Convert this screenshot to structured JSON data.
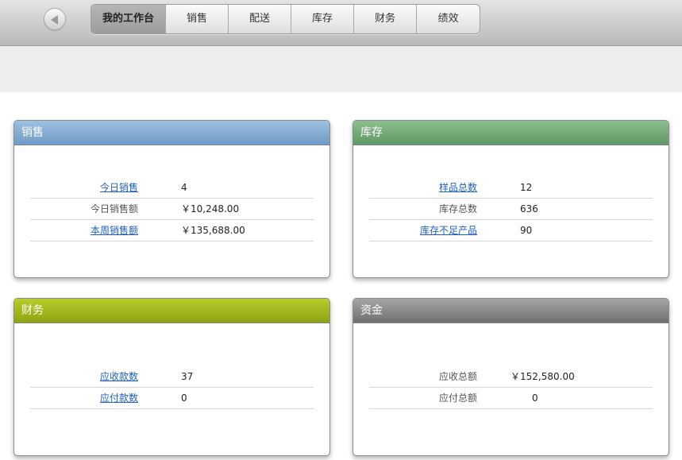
{
  "nav": {
    "back_icon": "back-arrow-icon",
    "tabs": [
      {
        "label": "我的工作台"
      },
      {
        "label": "销售"
      },
      {
        "label": "配送"
      },
      {
        "label": "库存"
      },
      {
        "label": "财务"
      },
      {
        "label": "绩效"
      }
    ],
    "active_tab": "我的工作台"
  },
  "panels": {
    "sales": {
      "title": "销售",
      "header_color": "#7aa5d0",
      "rows": [
        {
          "label": "今日销售",
          "value": "4",
          "link": true
        },
        {
          "label": "今日销售额",
          "value": "￥10,248.00",
          "link": false
        },
        {
          "label": "本周销售额",
          "value": "￥135,688.00",
          "link": true
        }
      ]
    },
    "inventory": {
      "title": "库存",
      "header_color": "#6fa373",
      "rows": [
        {
          "label": "样品总数",
          "value": "12",
          "link": true
        },
        {
          "label": "库存总数",
          "value": "636",
          "link": false
        },
        {
          "label": "库存不足产品",
          "value": "90",
          "link": true
        }
      ]
    },
    "finance": {
      "title": "财务",
      "header_color": "#9db51a",
      "rows": [
        {
          "label": "应收款数",
          "value": "37",
          "link": true
        },
        {
          "label": "应付款数",
          "value": "0",
          "link": true
        }
      ]
    },
    "funds": {
      "title": "资金",
      "header_color": "#808080",
      "rows": [
        {
          "label": "应收总额",
          "value": "￥152,580.00",
          "link": false
        },
        {
          "label": "应付总额",
          "value": "0",
          "link": false
        }
      ]
    }
  }
}
